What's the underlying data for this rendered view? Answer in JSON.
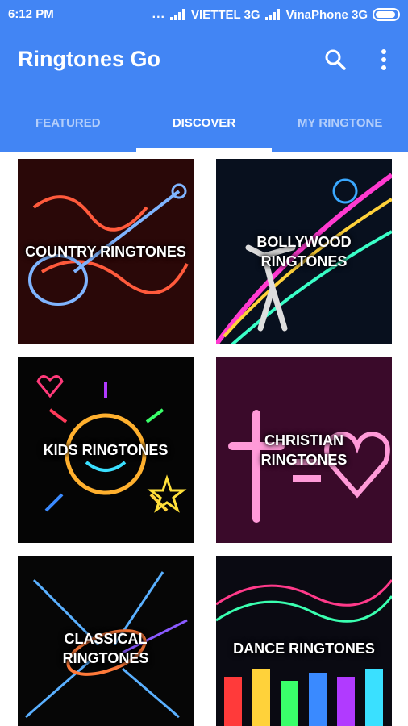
{
  "status_bar": {
    "time": "6:12 PM",
    "carrier1": "VIETTEL 3G",
    "carrier2": "VinaPhone 3G",
    "dots": "..."
  },
  "app": {
    "title": "Ringtones Go",
    "search_icon": "search-icon",
    "more_icon": "more-vert-icon",
    "accent_color": "#4285f4"
  },
  "tabs": [
    {
      "label": "FEATURED",
      "active": false
    },
    {
      "label": "DISCOVER",
      "active": true
    },
    {
      "label": "MY RINGTONE",
      "active": false
    }
  ],
  "categories": [
    {
      "label": "COUNTRY RINGTONES"
    },
    {
      "label": "BOLLYWOOD RINGTONES"
    },
    {
      "label": "KIDS RINGTONES"
    },
    {
      "label": "CHRISTIAN RINGTONES"
    },
    {
      "label": "CLASSICAL RINGTONES"
    },
    {
      "label": "DANCE RINGTONES"
    }
  ]
}
